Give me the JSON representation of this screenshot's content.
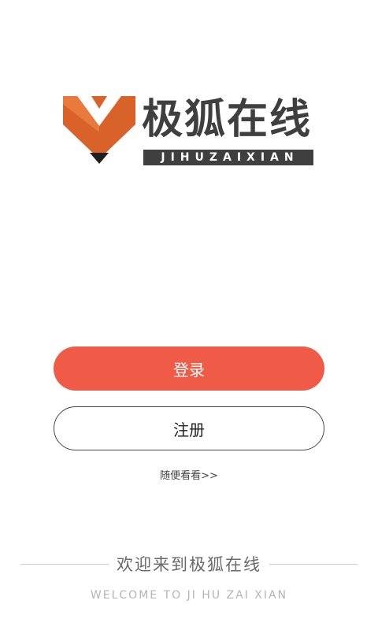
{
  "brand": {
    "title": "极狐在线",
    "subtitle": "JIHUZAIXIAN",
    "colors": {
      "orange": "#d9622b",
      "dark": "#3f3f3f"
    },
    "logo_icon": "fox-logo-icon"
  },
  "actions": {
    "login_label": "登录",
    "register_label": "注册",
    "browse_label": "随便看看>>",
    "colors": {
      "login_bg": "#ef5b46"
    }
  },
  "footer": {
    "welcome_cn": "欢迎来到极狐在线",
    "welcome_en": "WELCOME TO JI HU ZAI XIAN"
  }
}
